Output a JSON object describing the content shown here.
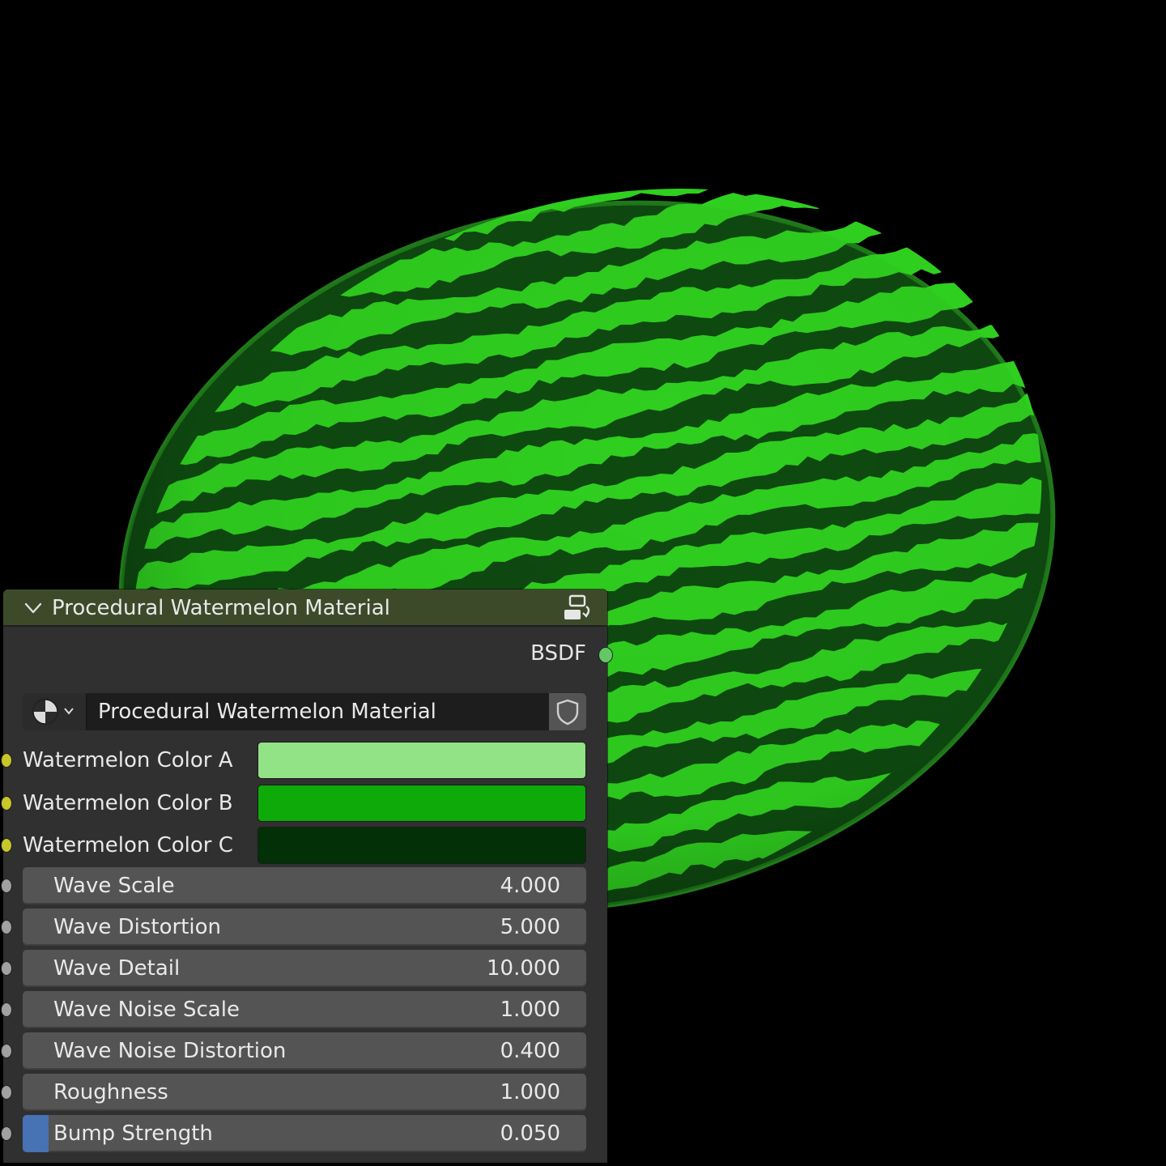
{
  "viewport": {
    "background": "#000000",
    "object": "watermelon",
    "stripe_colors": {
      "light": "#2fcf1f",
      "dark": "#0e4a10",
      "outline": "#1f7a1a"
    }
  },
  "node": {
    "title": "Procedural Watermelon Material",
    "header_color": "#3c4a2a",
    "output_socket": {
      "label": "BSDF",
      "color": "#63c763"
    },
    "material_selector": {
      "name": "Procedural Watermelon Material"
    },
    "color_inputs": [
      {
        "label": "Watermelon Color A",
        "color": "#92e286",
        "socket_color": "#c7c729"
      },
      {
        "label": "Watermelon Color B",
        "color": "#0eaa0a",
        "socket_color": "#c7c729"
      },
      {
        "label": "Watermelon Color C",
        "color": "#043007",
        "socket_color": "#c7c729"
      }
    ],
    "value_inputs": [
      {
        "label": "Wave Scale",
        "value": "4.000"
      },
      {
        "label": "Wave Distortion",
        "value": "5.000"
      },
      {
        "label": "Wave Detail",
        "value": "10.000"
      },
      {
        "label": "Wave Noise Scale",
        "value": "1.000"
      },
      {
        "label": "Wave Noise Distortion",
        "value": "0.400"
      },
      {
        "label": "Roughness",
        "value": "1.000"
      },
      {
        "label": "Bump Strength",
        "value": "0.050",
        "fill_fraction": 0.05
      }
    ],
    "value_socket_color": "#a1a1a1",
    "slider_fill_color": "#4772b3"
  }
}
